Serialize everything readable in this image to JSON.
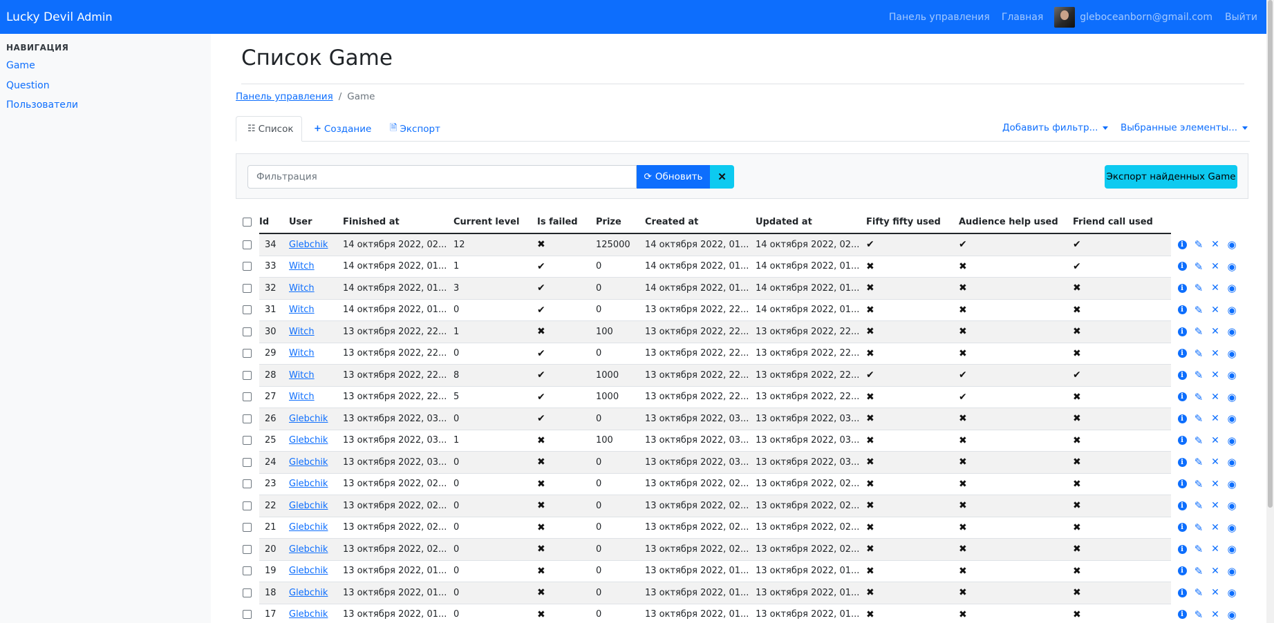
{
  "navbar": {
    "brand": "Lucky Devil",
    "brand_sub": "Admin",
    "links": [
      "Панель управления",
      "Главная"
    ],
    "user_email": "gleboceanborn@gmail.com",
    "logout": "Выйти"
  },
  "sidebar": {
    "heading": "НАВИГАЦИЯ",
    "items": [
      "Game",
      "Question",
      "Пользователи"
    ]
  },
  "page": {
    "title": "Список Game",
    "breadcrumb": {
      "root": "Панель управления",
      "current": "Game"
    }
  },
  "tabs": {
    "list": "Список",
    "create": "Создание",
    "export": "Экспорт",
    "add_filter": "Добавить фильтр...",
    "selected": "Выбранные элементы..."
  },
  "filter": {
    "placeholder": "Фильтрация",
    "refresh": "Обновить",
    "export_found": "Экспорт найденных Game"
  },
  "table": {
    "columns": [
      "Id",
      "User",
      "Finished at",
      "Current level",
      "Is failed",
      "Prize",
      "Created at",
      "Updated at",
      "Fifty fifty used",
      "Audience help used",
      "Friend call used"
    ],
    "rows": [
      {
        "id": "34",
        "user": "Glebchik",
        "finished": "14 октября 2022, 02...",
        "level": "12",
        "failed": false,
        "prize": "125000",
        "created": "14 октября 2022, 01...",
        "updated": "14 октября 2022, 02...",
        "fifty": true,
        "audience": true,
        "friend": true
      },
      {
        "id": "33",
        "user": "Witch",
        "finished": "14 октября 2022, 01...",
        "level": "1",
        "failed": true,
        "prize": "0",
        "created": "14 октября 2022, 01...",
        "updated": "14 октября 2022, 01...",
        "fifty": false,
        "audience": false,
        "friend": true
      },
      {
        "id": "32",
        "user": "Witch",
        "finished": "14 октября 2022, 01...",
        "level": "3",
        "failed": true,
        "prize": "0",
        "created": "14 октября 2022, 01...",
        "updated": "14 октября 2022, 01...",
        "fifty": false,
        "audience": false,
        "friend": false
      },
      {
        "id": "31",
        "user": "Witch",
        "finished": "14 октября 2022, 01...",
        "level": "0",
        "failed": true,
        "prize": "0",
        "created": "13 октября 2022, 22...",
        "updated": "14 октября 2022, 01...",
        "fifty": false,
        "audience": false,
        "friend": false
      },
      {
        "id": "30",
        "user": "Witch",
        "finished": "13 октября 2022, 22...",
        "level": "1",
        "failed": false,
        "prize": "100",
        "created": "13 октября 2022, 22...",
        "updated": "13 октября 2022, 22...",
        "fifty": false,
        "audience": false,
        "friend": false
      },
      {
        "id": "29",
        "user": "Witch",
        "finished": "13 октября 2022, 22...",
        "level": "0",
        "failed": true,
        "prize": "0",
        "created": "13 октября 2022, 22...",
        "updated": "13 октября 2022, 22...",
        "fifty": false,
        "audience": false,
        "friend": false
      },
      {
        "id": "28",
        "user": "Witch",
        "finished": "13 октября 2022, 22...",
        "level": "8",
        "failed": true,
        "prize": "1000",
        "created": "13 октября 2022, 22...",
        "updated": "13 октября 2022, 22...",
        "fifty": true,
        "audience": true,
        "friend": true
      },
      {
        "id": "27",
        "user": "Witch",
        "finished": "13 октября 2022, 22...",
        "level": "5",
        "failed": true,
        "prize": "1000",
        "created": "13 октября 2022, 22...",
        "updated": "13 октября 2022, 22...",
        "fifty": false,
        "audience": true,
        "friend": false
      },
      {
        "id": "26",
        "user": "Glebchik",
        "finished": "13 октября 2022, 03...",
        "level": "0",
        "failed": true,
        "prize": "0",
        "created": "13 октября 2022, 03...",
        "updated": "13 октября 2022, 03...",
        "fifty": false,
        "audience": false,
        "friend": false
      },
      {
        "id": "25",
        "user": "Glebchik",
        "finished": "13 октября 2022, 03...",
        "level": "1",
        "failed": false,
        "prize": "100",
        "created": "13 октября 2022, 03...",
        "updated": "13 октября 2022, 03...",
        "fifty": false,
        "audience": false,
        "friend": false
      },
      {
        "id": "24",
        "user": "Glebchik",
        "finished": "13 октября 2022, 03...",
        "level": "0",
        "failed": false,
        "prize": "0",
        "created": "13 октября 2022, 03...",
        "updated": "13 октября 2022, 03...",
        "fifty": false,
        "audience": false,
        "friend": false
      },
      {
        "id": "23",
        "user": "Glebchik",
        "finished": "13 октября 2022, 02...",
        "level": "0",
        "failed": false,
        "prize": "0",
        "created": "13 октября 2022, 02...",
        "updated": "13 октября 2022, 02...",
        "fifty": false,
        "audience": false,
        "friend": false
      },
      {
        "id": "22",
        "user": "Glebchik",
        "finished": "13 октября 2022, 02...",
        "level": "0",
        "failed": false,
        "prize": "0",
        "created": "13 октября 2022, 02...",
        "updated": "13 октября 2022, 02...",
        "fifty": false,
        "audience": false,
        "friend": false
      },
      {
        "id": "21",
        "user": "Glebchik",
        "finished": "13 октября 2022, 02...",
        "level": "0",
        "failed": false,
        "prize": "0",
        "created": "13 октября 2022, 02...",
        "updated": "13 октября 2022, 02...",
        "fifty": false,
        "audience": false,
        "friend": false
      },
      {
        "id": "20",
        "user": "Glebchik",
        "finished": "13 октября 2022, 02...",
        "level": "0",
        "failed": false,
        "prize": "0",
        "created": "13 октября 2022, 02...",
        "updated": "13 октября 2022, 02...",
        "fifty": false,
        "audience": false,
        "friend": false
      },
      {
        "id": "19",
        "user": "Glebchik",
        "finished": "13 октября 2022, 01...",
        "level": "0",
        "failed": false,
        "prize": "0",
        "created": "13 октября 2022, 01...",
        "updated": "13 октября 2022, 01...",
        "fifty": false,
        "audience": false,
        "friend": false
      },
      {
        "id": "18",
        "user": "Glebchik",
        "finished": "13 октября 2022, 01...",
        "level": "0",
        "failed": false,
        "prize": "0",
        "created": "13 октября 2022, 01...",
        "updated": "13 октября 2022, 01...",
        "fifty": false,
        "audience": false,
        "friend": false
      },
      {
        "id": "17",
        "user": "Glebchik",
        "finished": "13 октября 2022, 01...",
        "level": "0",
        "failed": false,
        "prize": "0",
        "created": "13 октября 2022, 01...",
        "updated": "13 октября 2022, 01...",
        "fifty": false,
        "audience": false,
        "friend": false
      }
    ]
  },
  "icons": {
    "check": "check-icon",
    "cross": "cross-icon",
    "row_actions": [
      "info-icon",
      "pencil-icon",
      "delete-icon",
      "eye-icon"
    ]
  },
  "colors": {
    "primary": "#0d6efd",
    "info": "#0dcaf0",
    "sidebar_bg": "#f8f9fa"
  }
}
